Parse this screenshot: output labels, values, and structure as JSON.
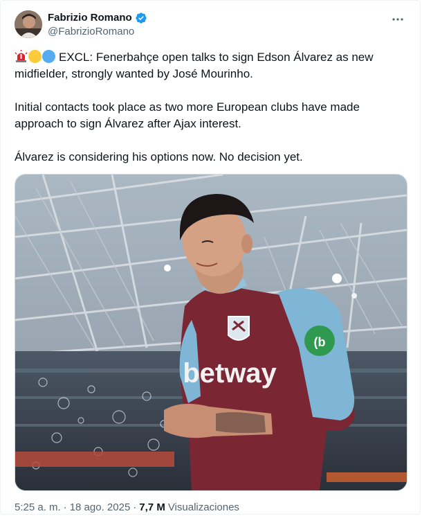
{
  "author": {
    "name": "Fabrizio Romano",
    "handle": "@FabrizioRomano",
    "verified_color": "#1d9bf0"
  },
  "icons": {
    "verified": "verified-badge-icon",
    "more": "more-options-icon",
    "siren": "rotating-light-emoji",
    "yellow": "yellow-circle-emoji",
    "blue": "blue-circle-emoji"
  },
  "tweet": {
    "line1": "EXCL: Fenerbahçe open talks to sign Edson Álvarez as new midfielder, strongly wanted by José Mourinho.",
    "paragraph2": "Initial contacts took place as two more European clubs have made approach to sign Álvarez after Ajax interest.",
    "paragraph3": "Álvarez is considering his options now. No decision yet."
  },
  "media": {
    "shirt_sponsor": "betway",
    "shirt_color": "#7a2633",
    "sleeve_color": "#7fb6d6"
  },
  "footer": {
    "time": "5:25 a. m.",
    "separator": "·",
    "date": "18 ago. 2025",
    "views_count": "7,7 M",
    "views_label": "Visualizaciones"
  }
}
